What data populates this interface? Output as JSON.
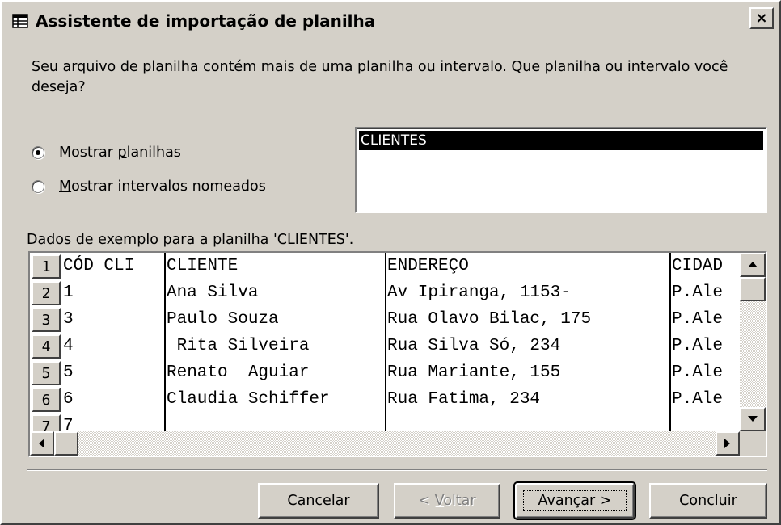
{
  "window": {
    "title": "Assistente de importação de planilha",
    "close_glyph": "×",
    "icon": "table-icon"
  },
  "question": "Seu arquivo de planilha contém mais de uma planilha ou intervalo. Que planilha ou intervalo você deseja?",
  "options": {
    "show_sheets": {
      "pre": "Mostrar ",
      "accel": "p",
      "post": "lanilhas",
      "checked": true
    },
    "show_ranges": {
      "pre": "",
      "accel": "M",
      "post": "ostrar intervalos nomeados",
      "checked": false
    }
  },
  "sheet_list": {
    "items": [
      "CLIENTES"
    ],
    "selected": "CLIENTES"
  },
  "sample_label": "Dados de exemplo para a planilha 'CLIENTES'.",
  "grid": {
    "row_numbers": [
      "1",
      "2",
      "3",
      "4",
      "5",
      "6",
      "7"
    ],
    "rows": [
      [
        "CÓD CLI",
        "CLIENTE",
        "ENDEREÇO",
        "CIDAD"
      ],
      [
        "1",
        "Ana Silva",
        "Av Ipiranga, 1153-",
        "P.Ale"
      ],
      [
        "3",
        "Paulo Souza",
        "Rua Olavo Bilac, 175",
        "P.Ale"
      ],
      [
        "4",
        " Rita Silveira",
        "Rua Silva Só, 234",
        "P.Ale"
      ],
      [
        "5",
        "Renato  Aguiar",
        "Rua Mariante, 155",
        "P.Ale"
      ],
      [
        "6",
        "Claudia Schiffer",
        "Rua Fatima, 234",
        "P.Ale"
      ],
      [
        "7",
        "",
        "",
        ""
      ]
    ]
  },
  "buttons": {
    "cancel": "Cancelar",
    "back": {
      "pre": "< ",
      "accel": "V",
      "post": "oltar"
    },
    "next": {
      "pre": "",
      "accel": "A",
      "post": "vançar >"
    },
    "finish": {
      "pre": "",
      "accel": "C",
      "post": "oncluir"
    }
  },
  "colors": {
    "face": "#d4d0c8",
    "selection": "#000000",
    "disabled_text": "#808080"
  }
}
